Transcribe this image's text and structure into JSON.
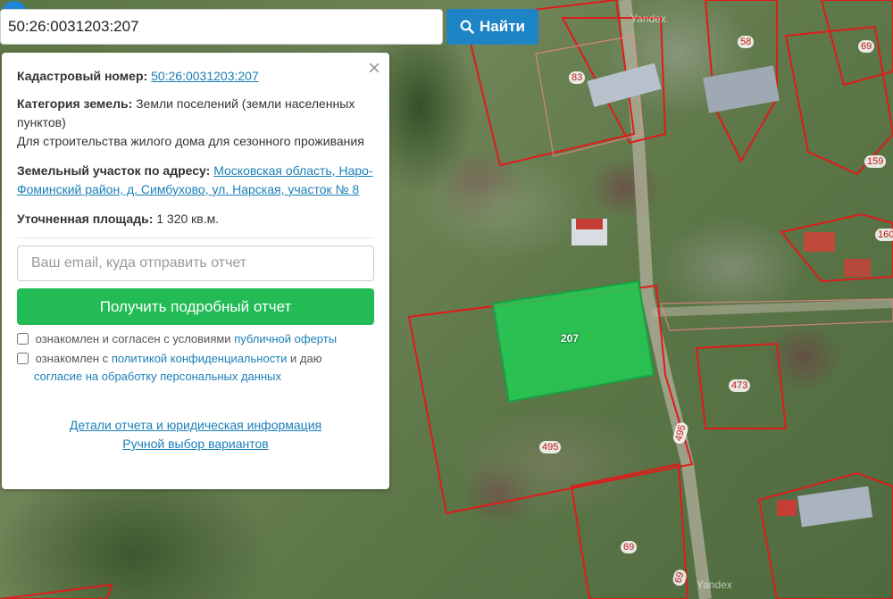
{
  "search": {
    "value": "50:26:0031203:207",
    "button_label": "Найти"
  },
  "panel": {
    "cadastral_label": "Кадастровый номер:",
    "cadastral_value": "50:26:0031203:207",
    "category_label": "Категория земель:",
    "category_value": "Земли поселений (земли населенных пунктов)",
    "usage": "Для строительства жилого дома для сезонного проживания",
    "address_label": "Земельный участок по адресу:",
    "address_value": "Московская область, Наро-Фоминский район, д. Симбухово, ул. Нарская, участок № 8",
    "area_label": "Уточненная площадь:",
    "area_value": "1 320 кв.м.",
    "email_placeholder": "Ваш email, куда отправить отчет",
    "report_button": "Получить подробный отчет",
    "consent1_text": "ознакомлен и согласен с условиями",
    "consent1_link": "публичной оферты",
    "consent2_text_a": "ознакомлен с",
    "consent2_link1": "политикой конфиденциальности",
    "consent2_text_b": "и даю",
    "consent2_link2": "согласие на обработку персональных данных",
    "details_link": "Детали отчета и юридическая информация",
    "manual_link": "Ручной выбор вариантов",
    "close_symbol": "×"
  },
  "map": {
    "selected_parcel_number": "207",
    "watermark": "Yandex",
    "parcel_labels": [
      "58",
      "69",
      "83",
      "159",
      "160",
      "473",
      "495",
      "495",
      "69",
      "69"
    ],
    "highlight_color": "#22cc55",
    "boundary_color": "#e01b1b"
  }
}
